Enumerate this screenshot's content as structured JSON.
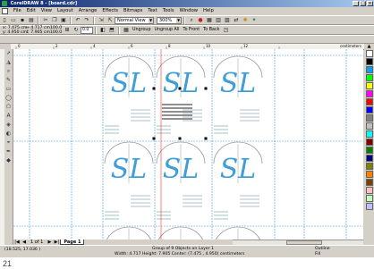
{
  "window": {
    "title": "CorelDRAW 8 - [board.cdr]",
    "controls": [
      "_",
      "□",
      "×"
    ]
  },
  "menu": [
    "File",
    "Edit",
    "View",
    "Layout",
    "Arrange",
    "Effects",
    "Bitmaps",
    "Text",
    "Tools",
    "Window",
    "Help"
  ],
  "toolbar": {
    "view_mode": "Normal View",
    "zoom": "300%"
  },
  "property_bar": {
    "x": "x: 7.475 cm",
    "y": "y: 4.950 cm",
    "w": "↔ 4.717 cm",
    "h": "↕ 7.905 cm",
    "scale_x": "100.0",
    "scale_y": "100.0",
    "angle": "0.0",
    "ungroup": "Ungroup",
    "ungroup_all": "Ungroup All",
    "to_front": "To Front",
    "to_back": "To Back"
  },
  "ruler": {
    "ticks": [
      "0",
      "2",
      "4",
      "6",
      "8",
      "10",
      "12"
    ],
    "unit": "centimeters"
  },
  "tabs": {
    "page_count": "1 of 1",
    "active_tab": "Page 1"
  },
  "status": {
    "cursor": "(18.525, 17.036 )",
    "selection": "Group of 9 Objects on Layer 1",
    "dimensions": "Width: 4.717  Height: 7.905  Center: (7.475 , 4.950)  centimeters",
    "outline_label": "Outline",
    "fill_label": "Fill"
  },
  "logo": {
    "text": "SL",
    "color": "#3f9dd8",
    "ring_color": "#9a9a9a"
  },
  "caption": "21",
  "colors": {
    "title_start": "#0a246a",
    "title_end": "#a6caf0",
    "chrome": "#d4d0c8",
    "guide": "#4a9ad8",
    "selection_guide": "#ff0000"
  },
  "palette_swatches": [
    "#ffffff",
    "#000000",
    "#00a0ff",
    "#00ff00",
    "#ffff00",
    "#ff00ff",
    "#ff0000",
    "#0000ff",
    "#808080",
    "#c0c0c0",
    "#00ffff",
    "#800000",
    "#008000",
    "#000080",
    "#808000",
    "#ff8000",
    "#804000",
    "#ffc0c0",
    "#c0ffc0",
    "#c0c0ff"
  ]
}
